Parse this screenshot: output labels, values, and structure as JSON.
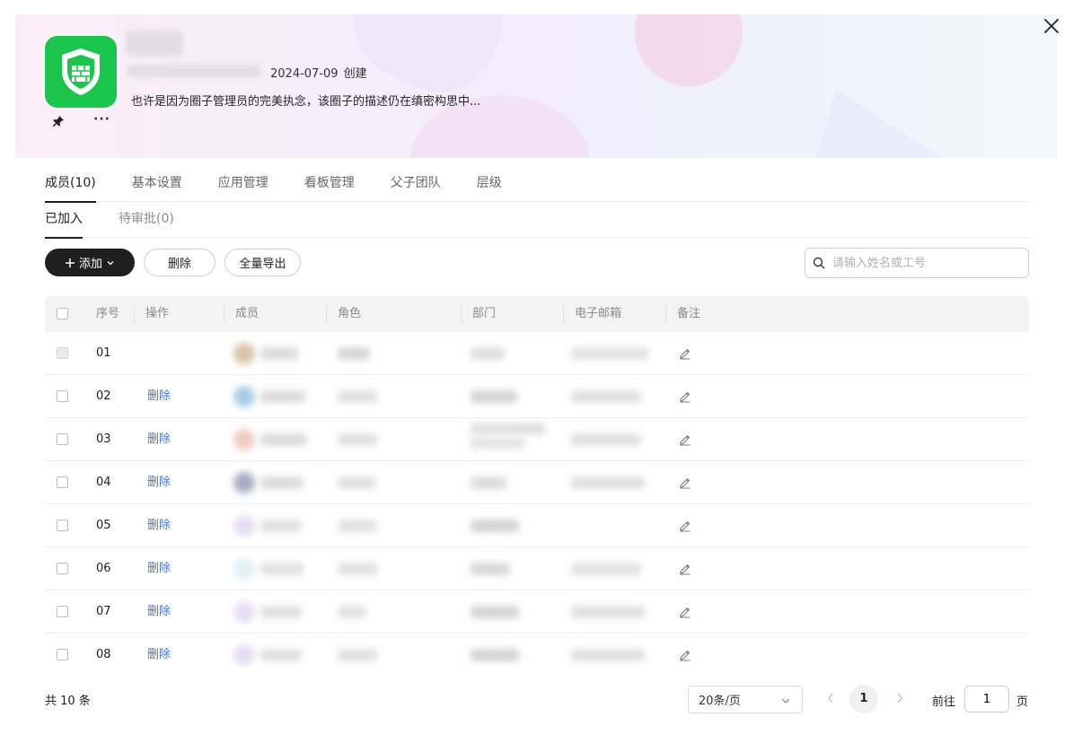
{
  "header": {
    "created_date": "2024-07-09",
    "created_label": "创建",
    "description": "也许是因为圈子管理员的完美执念，该圈子的描述仍在缜密构思中...",
    "more_label": "···"
  },
  "tabs": [
    {
      "label": "成员(10)"
    },
    {
      "label": "基本设置"
    },
    {
      "label": "应用管理"
    },
    {
      "label": "看板管理"
    },
    {
      "label": "父子团队"
    },
    {
      "label": "层级"
    }
  ],
  "subtabs": [
    {
      "label": "已加入"
    },
    {
      "label": "待审批(0)"
    }
  ],
  "toolbar": {
    "add_label": "添加",
    "delete_label": "删除",
    "export_label": "全量导出",
    "search_placeholder": "请输入姓名或工号"
  },
  "table": {
    "columns": [
      "序号",
      "操作",
      "成员",
      "角色",
      "部门",
      "电子邮箱",
      "备注"
    ],
    "rows": [
      {
        "index": "01",
        "action": ""
      },
      {
        "index": "02",
        "action": "删除"
      },
      {
        "index": "03",
        "action": "删除"
      },
      {
        "index": "04",
        "action": "删除"
      },
      {
        "index": "05",
        "action": "删除"
      },
      {
        "index": "06",
        "action": "删除"
      },
      {
        "index": "07",
        "action": "删除"
      },
      {
        "index": "08",
        "action": "删除"
      }
    ]
  },
  "footer": {
    "total": "共 10 条",
    "page_size": "20条/页",
    "current_page": "1",
    "goto_label": "前往",
    "goto_value": "1",
    "page_unit": "页"
  },
  "colors": {
    "accent": "#1f1f1f",
    "link": "#3b7be0",
    "logo_green": "#19c54b"
  }
}
